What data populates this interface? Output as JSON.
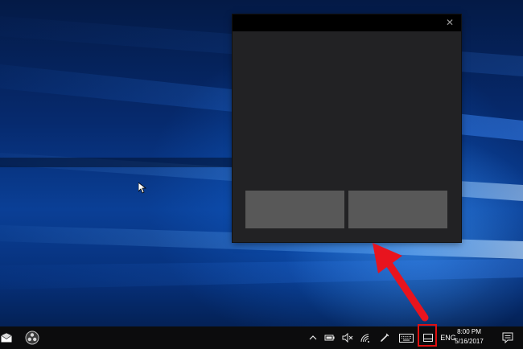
{
  "touchpad_window": {
    "close_glyph": "✕"
  },
  "taskbar": {
    "language": "ENG",
    "clock": {
      "time": "8:00 PM",
      "date": "5/16/2017"
    },
    "icons": [
      "mail-icon",
      "obs-icon",
      "chevron-up-icon",
      "battery-icon",
      "volume-muted-icon",
      "wifi-icon",
      "pen-icon",
      "keyboard-icon",
      "touchpad-icon",
      "notification-icon"
    ]
  },
  "colors": {
    "highlight": "#e01010",
    "arrow": "#e8141e",
    "window_bg": "#222224",
    "titlebar": "#000000",
    "touchpad_button": "#585858",
    "taskbar": "#0c0c0d"
  }
}
